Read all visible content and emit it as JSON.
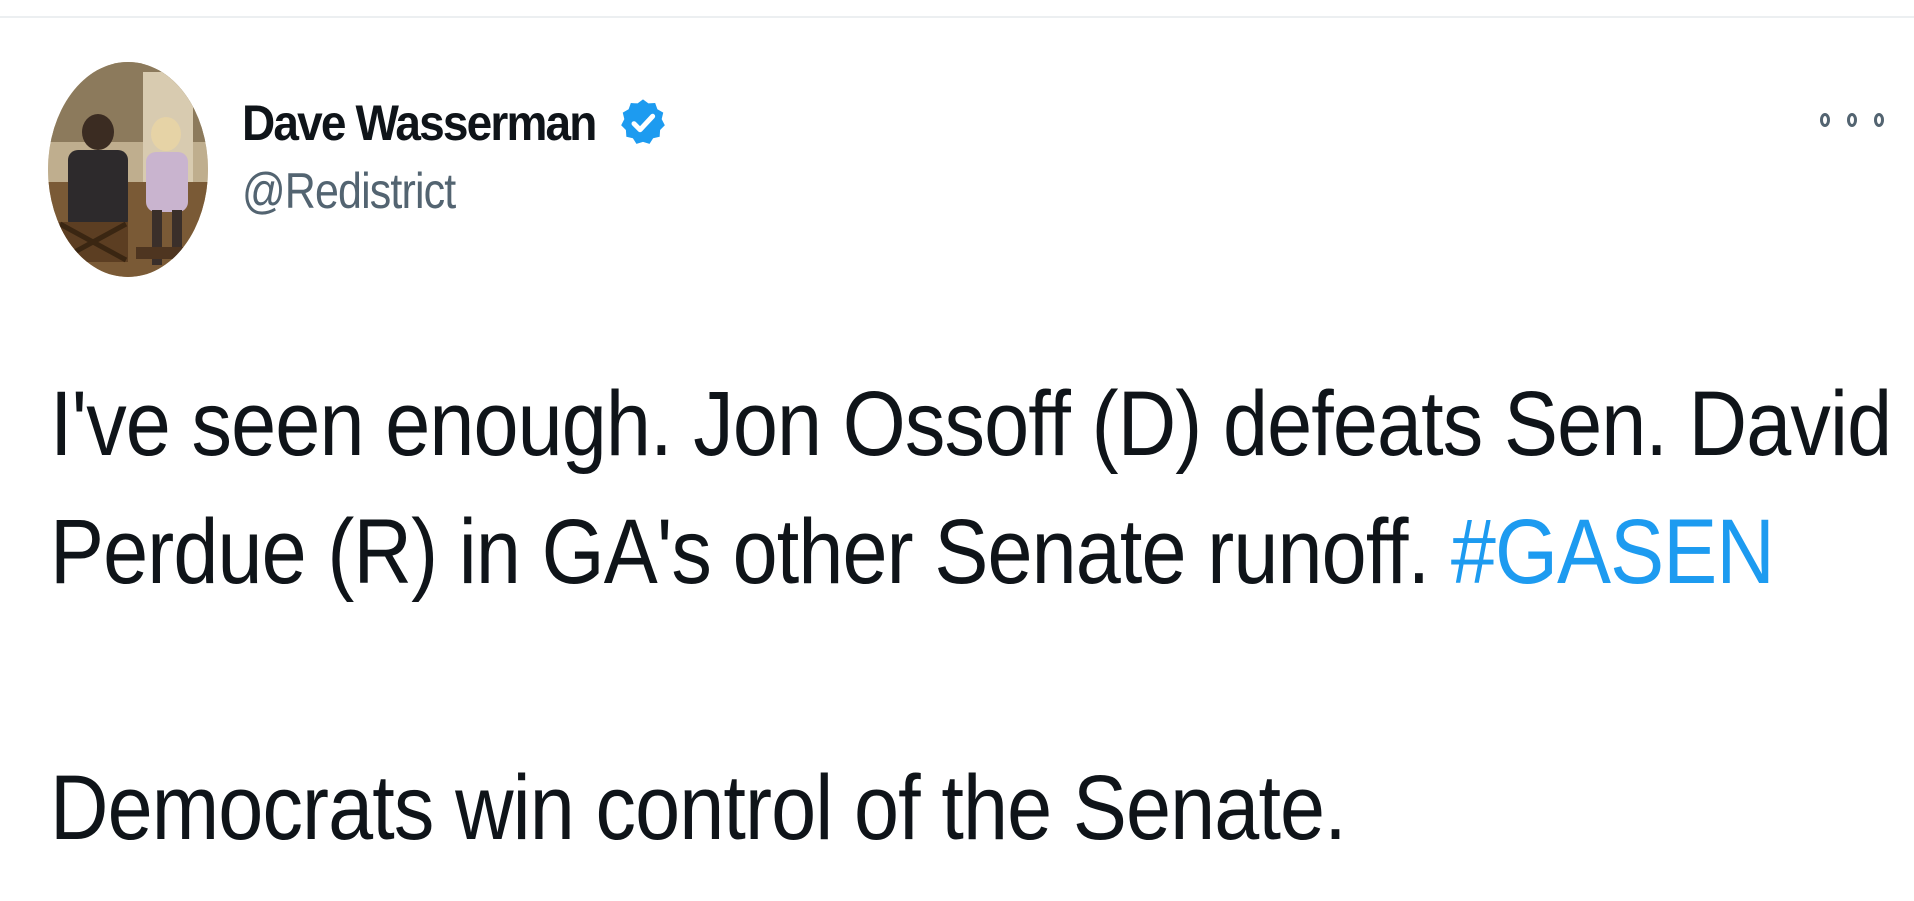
{
  "tweet": {
    "author": {
      "display_name": "Dave Wasserman",
      "handle": "@Redistrict",
      "verified": true,
      "avatar_icon": "profile-photo"
    },
    "more_icon": "more-options-icon",
    "text": {
      "line1": "I've seen enough. Jon Ossoff (D) defeats Sen. David",
      "line2_prefix": "Perdue (R) in GA's other Senate runoff. ",
      "hashtag": "#GASEN",
      "line3": "Democrats win control of the Senate."
    }
  },
  "colors": {
    "link": "#1d9bf0",
    "text": "#0f1419",
    "secondary": "#536471",
    "verified": "#1d9bf0"
  }
}
